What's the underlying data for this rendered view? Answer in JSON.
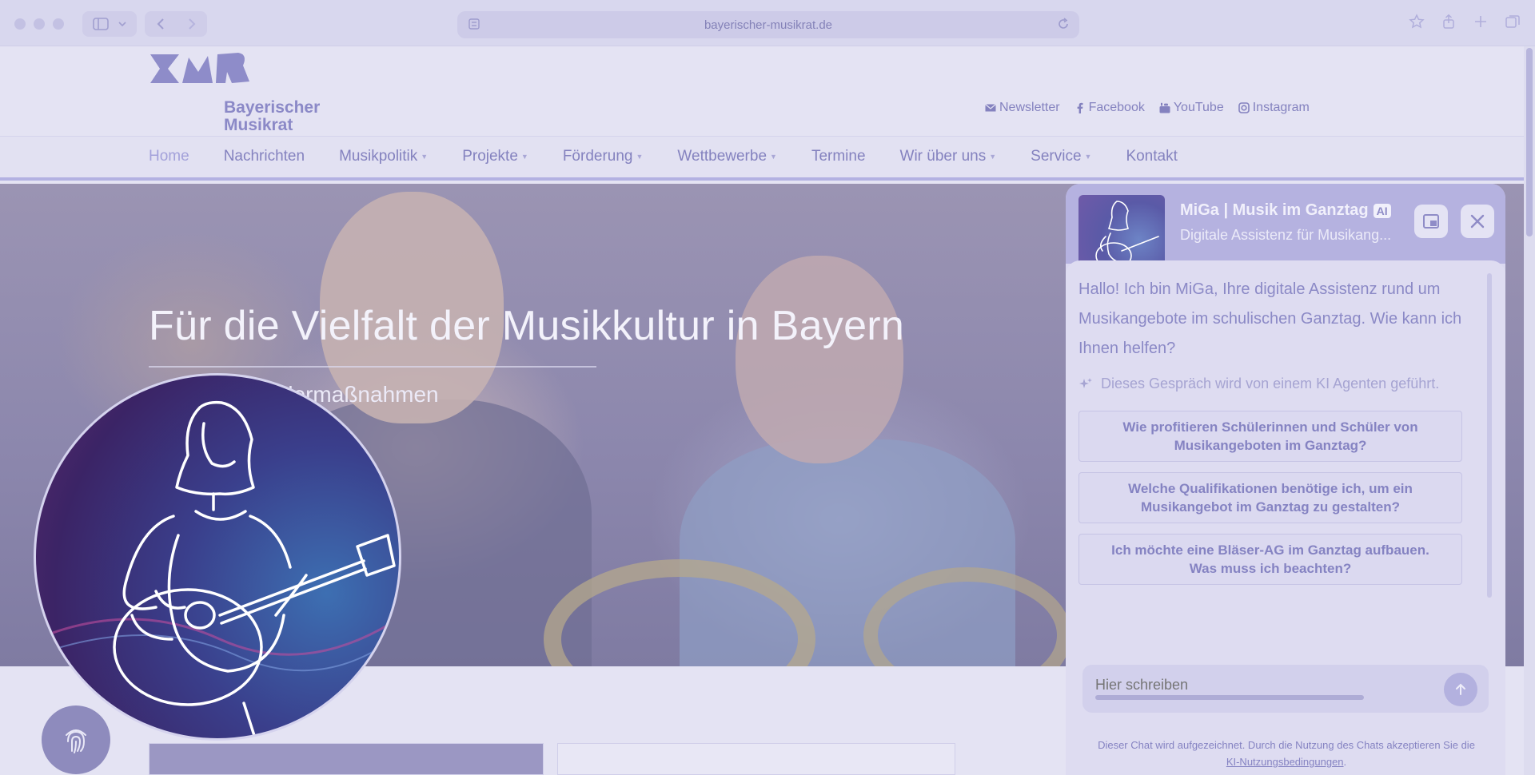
{
  "browser": {
    "url": "bayerischer-musikrat.de"
  },
  "site": {
    "logo_text_line1": "Bayerischer",
    "logo_text_line2": "Musikrat",
    "social": [
      {
        "label": "Newsletter",
        "icon": "envelope-icon"
      },
      {
        "label": "Facebook",
        "icon": "facebook-icon"
      },
      {
        "label": "YouTube",
        "icon": "youtube-icon"
      },
      {
        "label": "Instagram",
        "icon": "instagram-icon"
      }
    ],
    "nav": [
      {
        "label": "Home",
        "active": true,
        "dropdown": false
      },
      {
        "label": "Nachrichten",
        "dropdown": false
      },
      {
        "label": "Musikpolitik",
        "dropdown": true
      },
      {
        "label": "Projekte",
        "dropdown": true
      },
      {
        "label": "Förderung",
        "dropdown": true
      },
      {
        "label": "Wettbewerbe",
        "dropdown": true
      },
      {
        "label": "Termine",
        "dropdown": false
      },
      {
        "label": "Wir über uns",
        "dropdown": true
      },
      {
        "label": "Service",
        "dropdown": true
      },
      {
        "label": "Kontakt",
        "dropdown": false
      }
    ]
  },
  "hero": {
    "title": "Für die Vielfalt der Musikkultur in Bayern",
    "subtitle": "bewerbe, Fördermaßnahmen"
  },
  "chat": {
    "title": "MiGa | Musik im Ganztag",
    "badge": "AI",
    "subtitle": "Digitale Assistenz für Musikang...",
    "greeting": "Hallo! Ich bin MiGa, Ihre digitale Assistenz rund um Musikangebote im schulischen Ganztag. Wie kann ich Ihnen helfen?",
    "ki_note": "Dieses Gespräch wird von einem KI Agenten geführt.",
    "suggestions": [
      "Wie profitieren Schülerinnen und Schüler von Musikangeboten im Ganztag?",
      "Welche Qualifikationen benötige ich, um ein Musikangebot im Ganztag zu gestalten?",
      "Ich möchte eine Bläser-AG im Ganztag aufbauen. Was muss ich beachten?"
    ],
    "input_placeholder": "Hier schreiben",
    "disclaimer_text": "Dieser Chat wird aufgezeichnet. Durch die Nutzung des Chats akzeptieren Sie die",
    "disclaimer_link": "KI-Nutzungsbedingungen",
    "disclaimer_end": "."
  },
  "colors": {
    "accent": "#8482bf",
    "chat_header": "#b5b2e0",
    "page_bg": "#e4e3f3"
  }
}
